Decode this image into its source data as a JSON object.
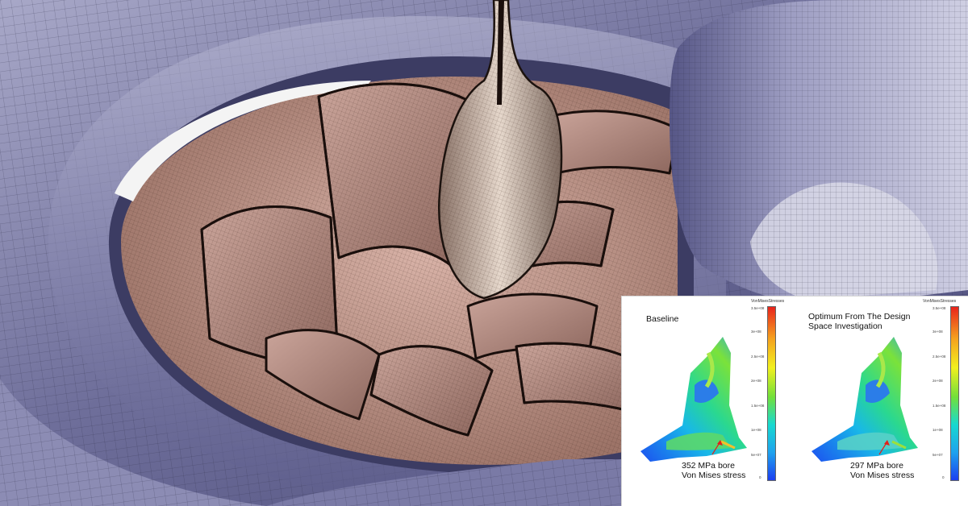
{
  "inset": {
    "left": {
      "title": "Baseline",
      "caption_line1": "352 MPa bore",
      "caption_line2": "Von Mises stress"
    },
    "right": {
      "title": "Optimum From The Design Space Investigation",
      "caption_line1": "297 MPa bore",
      "caption_line2": "Von Mises stress"
    },
    "colorbar_title": "VonMisesStresses",
    "colorbar_ticks": [
      "3.5e+08",
      "3e+08",
      "2.5e+08",
      "2e+08",
      "1.5e+08",
      "1e+08",
      "5e+07",
      "0"
    ]
  },
  "colors": {
    "casing": "#6f6f9e",
    "blade": "#b48e86",
    "hub": "#d8c6b8"
  }
}
